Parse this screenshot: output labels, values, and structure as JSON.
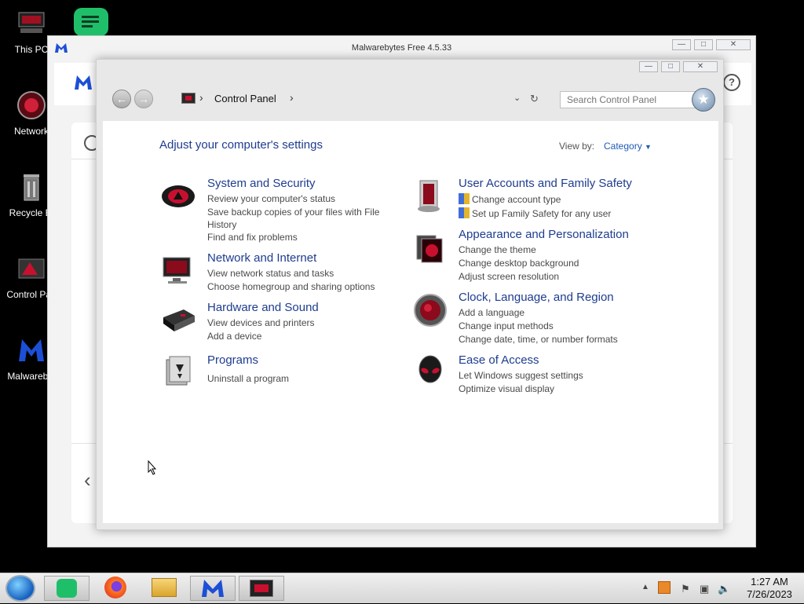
{
  "desktop": {
    "icons": [
      {
        "label": "This PC"
      },
      {
        "label": "Network"
      },
      {
        "label": "Recycle Bi"
      },
      {
        "label": "Control Pan"
      },
      {
        "label": "Malwarebyt"
      }
    ]
  },
  "malwarebytes": {
    "title": "Malwarebytes Free  4.5.33",
    "help_symbol": "?",
    "back_symbol": "‹"
  },
  "control_panel": {
    "breadcrumb": {
      "item": "Control Panel",
      "separator": "›"
    },
    "search_placeholder": "Search Control Panel",
    "heading": "Adjust your computer's settings",
    "view_by_label": "View by:",
    "view_by_value": "Category",
    "categories": [
      {
        "title": "System and Security",
        "icon": "system-security-icon",
        "links": [
          "Review your computer's status",
          "Save backup copies of your files with File",
          "History",
          "Find and fix problems"
        ]
      },
      {
        "title": "Network and Internet",
        "icon": "network-internet-icon",
        "links": [
          "View network status and tasks",
          "Choose homegroup and sharing options"
        ]
      },
      {
        "title": "Hardware and Sound",
        "icon": "hardware-sound-icon",
        "links": [
          "View devices and printers",
          "Add a device"
        ]
      },
      {
        "title": "Programs",
        "icon": "programs-icon",
        "links": [
          "Uninstall a program"
        ]
      },
      {
        "title": "User Accounts and Family Safety",
        "icon": "user-accounts-icon",
        "links": [
          "Change account type",
          "Set up Family Safety for any user"
        ]
      },
      {
        "title": "Appearance and Personalization",
        "icon": "appearance-icon",
        "links": [
          "Change the theme",
          "Change desktop background",
          "Adjust screen resolution"
        ]
      },
      {
        "title": "Clock, Language, and Region",
        "icon": "clock-region-icon",
        "links": [
          "Add a language",
          "Change input methods",
          "Change date, time, or number formats"
        ]
      },
      {
        "title": "Ease of Access",
        "icon": "ease-of-access-icon",
        "links": [
          "Let Windows suggest settings",
          "Optimize visual display"
        ]
      }
    ]
  },
  "taskbar": {
    "time": "1:27 AM",
    "date": "7/26/2023"
  },
  "colors": {
    "link_title": "#1e3d8f",
    "accent_red": "#c8102e",
    "malwarebytes_blue": "#1c4fd6"
  }
}
